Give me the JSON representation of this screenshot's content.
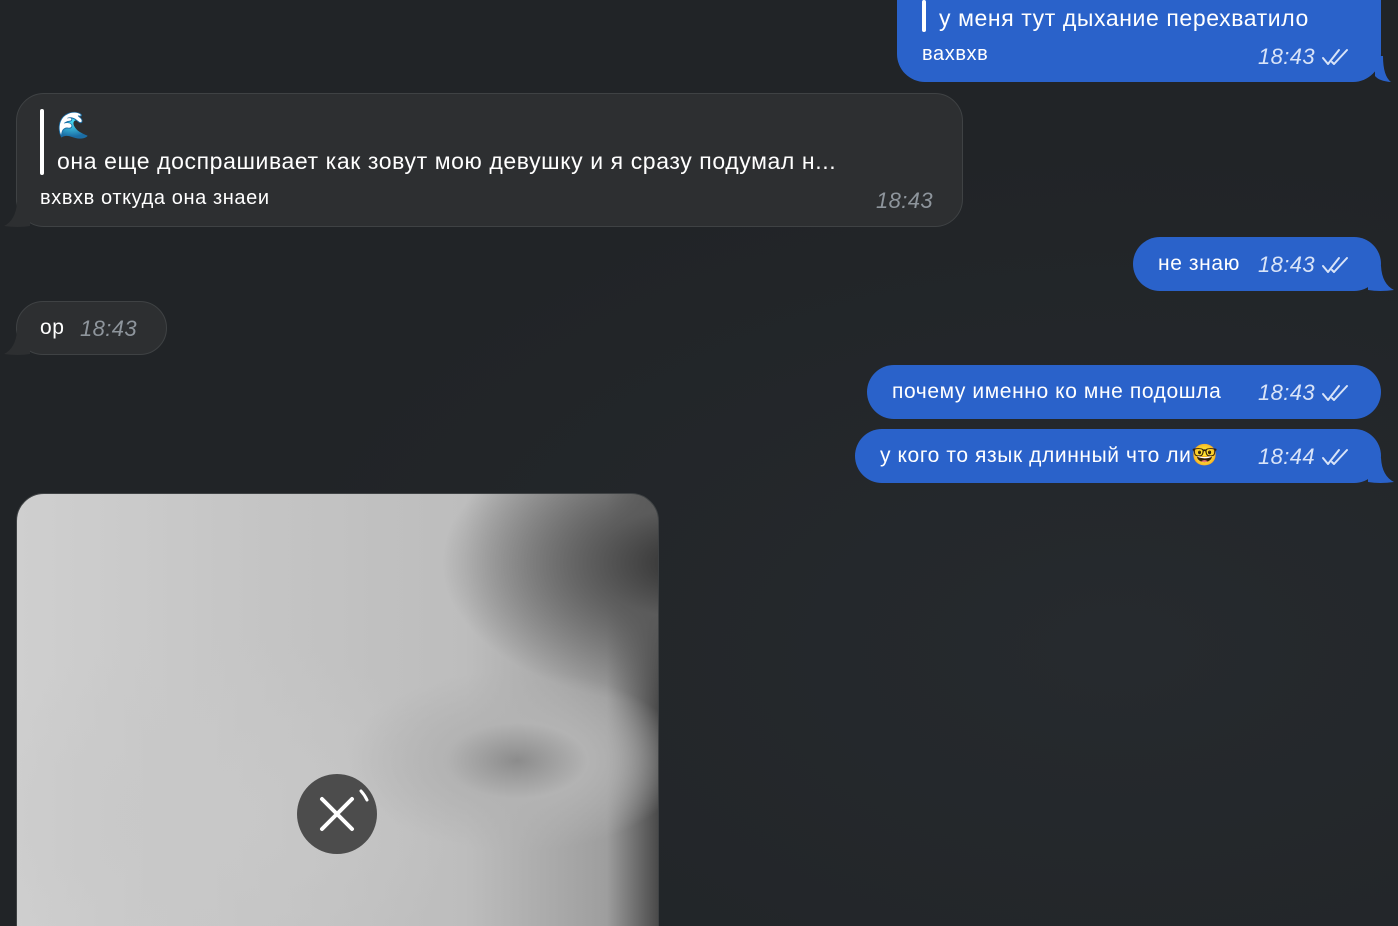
{
  "messages": {
    "m1": {
      "reply_text": "у меня тут дыхание перехватило",
      "text": "вахвхв",
      "time": "18:43"
    },
    "m2": {
      "reply_emoji": "🌊",
      "reply_text": "она еще доспрашивает как зовут мою девушку и я сразу подумал н...",
      "text": "вхвхв откуда она знаеи",
      "time": "18:43"
    },
    "m3": {
      "text": "не знаю",
      "time": "18:43"
    },
    "m4": {
      "text": "ор",
      "time": "18:43"
    },
    "m5": {
      "text": "почему именно ко мне подошла",
      "time": "18:43"
    },
    "m6": {
      "text": "у кого то язык длинный что ли",
      "emoji": "🤓",
      "time": "18:44"
    }
  },
  "icons": {
    "read_receipt": "double-check-icon",
    "cancel_download": "close-icon"
  },
  "colors": {
    "background": "#212427",
    "incoming_bubble": "#2d2f31",
    "outgoing_bubble": "#2a62ca"
  }
}
